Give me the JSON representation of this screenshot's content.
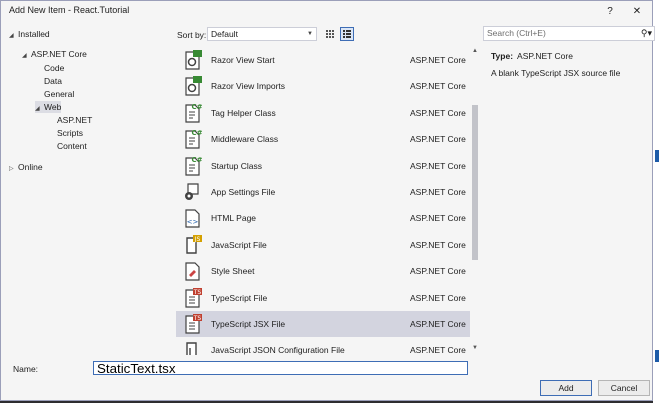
{
  "window": {
    "title": "Add New Item - React.Tutorial",
    "help_label": "?",
    "close_label": "✕"
  },
  "tree": [
    {
      "label": "Installed",
      "tri": "◢",
      "indent": 0,
      "selected": false
    },
    {
      "label": "ASP.NET Core",
      "tri": "◢",
      "indent": 1,
      "selected": false
    },
    {
      "label": "Code",
      "tri": "",
      "indent": 2,
      "selected": false
    },
    {
      "label": "Data",
      "tri": "",
      "indent": 2,
      "selected": false
    },
    {
      "label": "General",
      "tri": "",
      "indent": 2,
      "selected": false
    },
    {
      "label": "Web",
      "tri": "◢",
      "indent": 2,
      "selected": true
    },
    {
      "label": "ASP.NET",
      "tri": "",
      "indent": 3,
      "selected": false
    },
    {
      "label": "Scripts",
      "tri": "",
      "indent": 3,
      "selected": false
    },
    {
      "label": "Content",
      "tri": "",
      "indent": 3,
      "selected": false
    },
    {
      "label": "Online",
      "tri": "▷",
      "indent": 0,
      "selected": false
    }
  ],
  "toolbar": {
    "sort_label": "Sort by:",
    "sort_value": "Default",
    "search_placeholder": "Search (Ctrl+E)",
    "search_icon": "⚲▾"
  },
  "items": [
    {
      "name": "Razor View Start",
      "category": "ASP.NET Core",
      "icon": "razor-icon",
      "selected": false
    },
    {
      "name": "Razor View Imports",
      "category": "ASP.NET Core",
      "icon": "razor-icon",
      "selected": false
    },
    {
      "name": "Tag Helper Class",
      "category": "ASP.NET Core",
      "icon": "csharp-class-icon",
      "selected": false
    },
    {
      "name": "Middleware Class",
      "category": "ASP.NET Core",
      "icon": "csharp-class-icon",
      "selected": false
    },
    {
      "name": "Startup Class",
      "category": "ASP.NET Core",
      "icon": "csharp-class-icon",
      "selected": false
    },
    {
      "name": "App Settings File",
      "category": "ASP.NET Core",
      "icon": "settings-file-icon",
      "selected": false
    },
    {
      "name": "HTML Page",
      "category": "ASP.NET Core",
      "icon": "html-file-icon",
      "selected": false
    },
    {
      "name": "JavaScript File",
      "category": "ASP.NET Core",
      "icon": "js-file-icon",
      "selected": false
    },
    {
      "name": "Style Sheet",
      "category": "ASP.NET Core",
      "icon": "stylesheet-icon",
      "selected": false
    },
    {
      "name": "TypeScript File",
      "category": "ASP.NET Core",
      "icon": "ts-file-icon",
      "selected": false
    },
    {
      "name": "TypeScript JSX File",
      "category": "ASP.NET Core",
      "icon": "tsx-file-icon",
      "selected": true
    },
    {
      "name": "JavaScript JSON Configuration File",
      "category": "ASP.NET Core",
      "icon": "json-file-icon",
      "selected": false
    }
  ],
  "details": {
    "type_label": "Type:",
    "type_value": "ASP.NET Core",
    "description": "A blank TypeScript JSX source file"
  },
  "name_field": {
    "label": "Name:",
    "value": "StaticText.tsx"
  },
  "buttons": {
    "add": "Add",
    "cancel": "Cancel"
  },
  "colors": {
    "accent": "#3e6db5",
    "selection": "#d3d4df",
    "dialog_bg": "#f5f5f5"
  }
}
